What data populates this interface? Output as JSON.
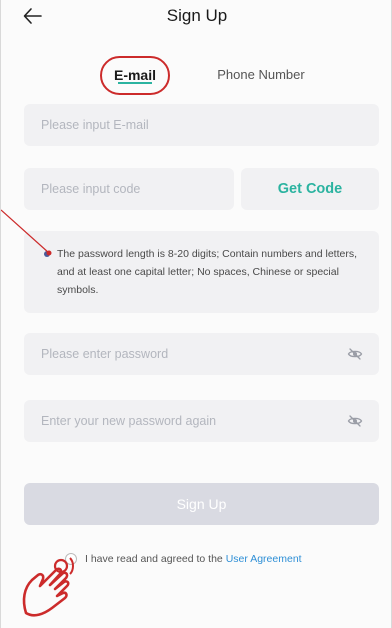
{
  "header": {
    "title": "Sign Up",
    "back_icon": "arrow-left-icon"
  },
  "tabs": [
    {
      "label": "E-mail",
      "active": true
    },
    {
      "label": "Phone Number",
      "active": false
    }
  ],
  "form": {
    "email_placeholder": "Please input E-mail",
    "code_placeholder": "Please input code",
    "get_code_label": "Get Code",
    "password_hint": "The password length is 8-20 digits; Contain numbers and letters, and at least one capital letter; No spaces, Chinese or special symbols.",
    "password_placeholder": "Please enter password",
    "confirm_placeholder": "Enter your new password again",
    "eye_icon": "eye-off-icon",
    "submit_label": "Sign Up"
  },
  "agreement": {
    "text": "I have read and agreed to the ",
    "link": "User Agreement"
  },
  "colors": {
    "accent": "#2bb3a0",
    "annotation": "#cc2b2b",
    "link": "#2e8fd6",
    "disabled_button": "#d9dae2"
  }
}
